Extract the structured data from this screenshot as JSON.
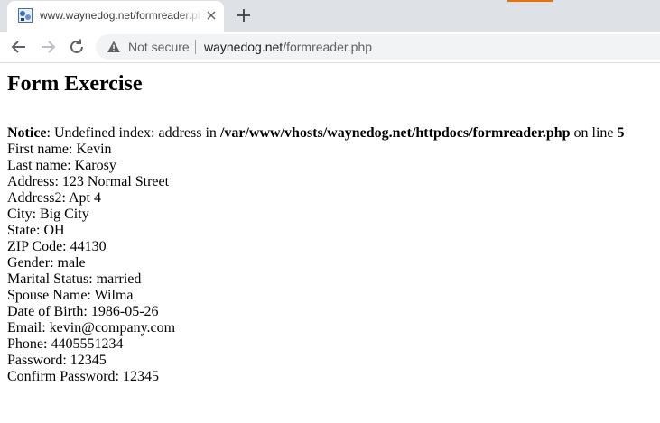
{
  "browser": {
    "tab_title": "www.waynedog.net/formreader.php",
    "security_label": "Not secure",
    "url_domain": "waynedog.net",
    "url_path": "/formreader.php"
  },
  "page": {
    "heading": "Form Exercise",
    "notice": {
      "label": "Notice",
      "message_start": ": Undefined index: address in ",
      "path": "/var/www/vhosts/waynedog.net/httpdocs/formreader.php",
      "message_mid": " on line ",
      "line": "5"
    },
    "fields": [
      "First name: Kevin",
      "Last name: Karosy",
      "Address: 123 Normal Street",
      "Address2: Apt 4",
      "City: Big City",
      "State: OH",
      "ZIP Code: 44130",
      "Gender: male",
      "Marital Status: married",
      "Spouse Name: Wilma",
      "Date of Birth: 1986-05-26",
      "Email: kevin@company.com",
      "Phone: 4405551234",
      "Password: 12345",
      "Confirm Password: 12345"
    ]
  },
  "colors": {
    "tabstrip": "#dee1e6",
    "omnibox": "#f1f3f4",
    "accent_orange": "#e8710a"
  },
  "icons": [
    "favicon-icon",
    "close-icon",
    "plus-icon",
    "back-arrow-icon",
    "forward-arrow-icon",
    "reload-icon",
    "warning-icon"
  ]
}
